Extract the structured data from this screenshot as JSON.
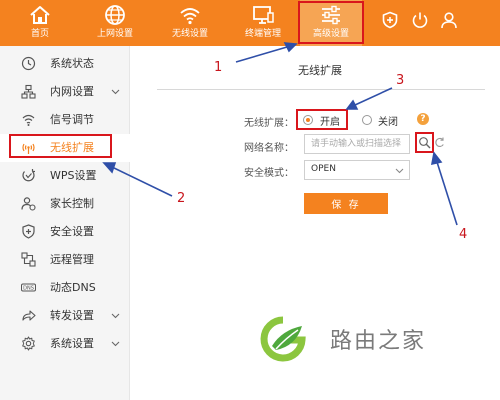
{
  "nav": [
    {
      "label": "首页",
      "icon": "home-icon"
    },
    {
      "label": "上网设置",
      "icon": "globe-icon"
    },
    {
      "label": "无线设置",
      "icon": "wifi-icon"
    },
    {
      "label": "终端管理",
      "icon": "monitor-icon"
    },
    {
      "label": "高级设置",
      "icon": "sliders-icon",
      "active": true
    }
  ],
  "header_icons": [
    "shield-plus-icon",
    "power-icon",
    "user-icon"
  ],
  "sidebar": {
    "items": [
      {
        "label": "系统状态",
        "icon": "clock-icon"
      },
      {
        "label": "内网设置",
        "icon": "network-icon",
        "expandable": true
      },
      {
        "label": "信号调节",
        "icon": "signal-icon"
      },
      {
        "label": "无线扩展",
        "icon": "wireless-extend-icon",
        "active": true
      },
      {
        "label": "WPS设置",
        "icon": "wps-icon"
      },
      {
        "label": "家长控制",
        "icon": "parent-control-icon"
      },
      {
        "label": "安全设置",
        "icon": "shield-icon"
      },
      {
        "label": "远程管理",
        "icon": "remote-icon"
      },
      {
        "label": "动态DNS",
        "icon": "dns-icon"
      },
      {
        "label": "转发设置",
        "icon": "forward-icon",
        "expandable": true
      },
      {
        "label": "系统设置",
        "icon": "gear-icon",
        "expandable": true
      }
    ]
  },
  "main": {
    "title": "无线扩展",
    "extend_label": "无线扩展：",
    "on_label": "开启",
    "off_label": "关闭",
    "help_label": "?",
    "ssid_label": "网络名称：",
    "ssid_placeholder": "请手动输入或扫描选择",
    "security_label": "安全模式：",
    "security_value": "OPEN",
    "save_label": "保 存"
  },
  "annotations": [
    "1",
    "2",
    "3",
    "4"
  ],
  "watermark": "路由之家",
  "colors": {
    "accent": "#f4821f",
    "annotation": "#d9161c",
    "sidebar_bg": "#f5f5f5"
  }
}
